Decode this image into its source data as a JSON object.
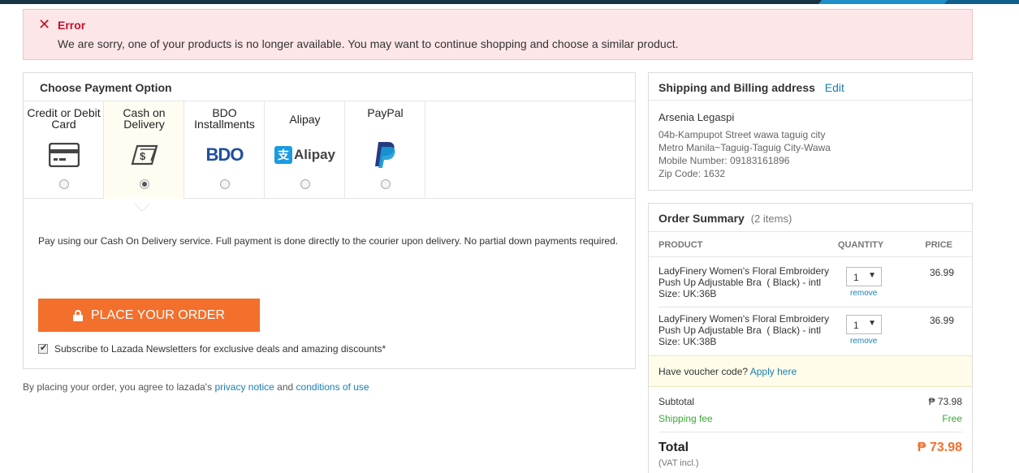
{
  "colors": {
    "accent": "#f36f2c",
    "link": "#1a7fb2",
    "error": "#c8102e",
    "free": "#3aa935",
    "topbar": "#1a3447"
  },
  "error": {
    "icon": "close-icon",
    "title": "Error",
    "message": "We are sorry, one of your products is no longer available. You may want to continue shopping and choose a similar product."
  },
  "payment": {
    "title": "Choose Payment Option",
    "options": [
      {
        "label": "Credit or Debit Card",
        "icon": "credit-card-icon",
        "selected": false
      },
      {
        "label": "Cash on Delivery",
        "icon": "cash-icon",
        "selected": true
      },
      {
        "label": "BDO Installments",
        "icon": "bdo-logo",
        "selected": false
      },
      {
        "label": "Alipay",
        "icon": "alipay-logo",
        "selected": false
      },
      {
        "label": "PayPal",
        "icon": "paypal-logo",
        "selected": false
      }
    ],
    "logos": {
      "bdo": "BDO",
      "alipay": "Alipay"
    },
    "cod_description": "Pay using our Cash On Delivery service. Full payment is done directly to the courier upon delivery. No partial down payments required.",
    "place_order_label": "PLACE YOUR ORDER",
    "subscribe_label": "Subscribe to Lazada Newsletters for exclusive deals and amazing discounts*",
    "subscribe_checked": true
  },
  "legal": {
    "prefix": "By placing your order, you agree to lazada's",
    "privacy": "privacy notice",
    "and": "and",
    "conditions": "conditions of use"
  },
  "shipping": {
    "title": "Shipping and Billing address",
    "edit": "Edit",
    "name": "Arsenia Legaspi",
    "street": "04b-Kampupot Street wawa taguig city",
    "region": "Metro Manila~Taguig-Taguig City-Wawa",
    "mobile": "Mobile Number: 09183161896",
    "zip": "Zip Code: 1632"
  },
  "summary": {
    "title": "Order Summary",
    "count": "(2 items)",
    "columns": {
      "product": "PRODUCT",
      "quantity": "QUANTITY",
      "price": "PRICE"
    },
    "items": [
      {
        "name": "LadyFinery Women's Floral Embroidery Push Up Adjustable Bra  ( Black) - intl",
        "size": "Size: UK:36B",
        "qty": "1",
        "remove": "remove",
        "price": "36.99"
      },
      {
        "name": "LadyFinery Women's Floral Embroidery Push Up Adjustable Bra  ( Black) - intl",
        "size": "Size: UK:38B",
        "qty": "1",
        "remove": "remove",
        "price": "36.99"
      }
    ],
    "voucher_text": "Have voucher code?",
    "voucher_link": "Apply here",
    "subtotal_label": "Subtotal",
    "subtotal_value": "₱ 73.98",
    "shipping_label": "Shipping fee",
    "shipping_value": "Free",
    "total_label": "Total",
    "total_value": "₱ 73.98",
    "vat": "(VAT incl.)"
  }
}
